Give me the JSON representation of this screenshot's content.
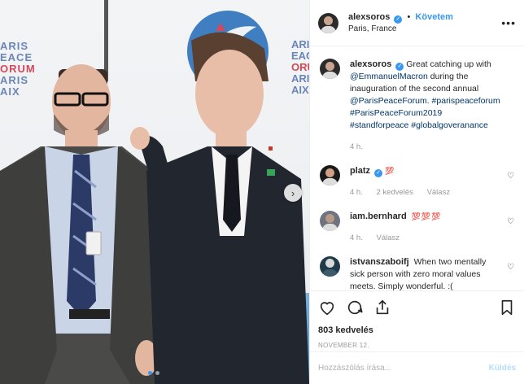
{
  "post": {
    "author": "alexsoros",
    "follow_label": "Követem",
    "separator": "•",
    "location": "Paris, France",
    "more_icon": "more-horizontal-icon",
    "photo": {
      "backdrop_left": [
        "ARIS",
        "EACE",
        "ORUM",
        "ARIS",
        "AIX"
      ],
      "backdrop_right": [
        "ARIS",
        "EACE",
        "ORUM",
        "ARIS",
        "AIX"
      ],
      "slide_count": 2,
      "active_slide": 1
    },
    "caption": {
      "user": "alexsoros",
      "text_1": "Great catching up with ",
      "mention_1": "@EmmanuelMacron",
      "text_2": " during the inauguration of the second annual ",
      "mention_2": "@ParisPeaceForum",
      "text_3": ". ",
      "tags": "#parispeaceforum #ParisPeaceForum2019 #standforpeace #globalgoveranance",
      "time": "4 h."
    },
    "comments": [
      {
        "user": "platz",
        "verified": true,
        "text": "💯",
        "time": "4 h.",
        "likes": "2 kedvelés",
        "reply": "Válasz"
      },
      {
        "user": "iam.bernhard",
        "verified": false,
        "text": "💯💯💯",
        "time": "4 h.",
        "likes": "",
        "reply": "Válasz"
      },
      {
        "user": "istvanszaboifj",
        "verified": false,
        "text": "When two mentally sick person with zero moral values meets. Simply wonderful. :(",
        "time": "",
        "likes": "",
        "reply": ""
      }
    ],
    "likes_count": "803 kedvelés",
    "date": "NOVEMBER 12.",
    "composer_placeholder": "Hozzászólás írása...",
    "post_label": "Küldés",
    "colors": {
      "accent": "#3897f0",
      "text": "#262626",
      "muted": "#999999"
    }
  }
}
